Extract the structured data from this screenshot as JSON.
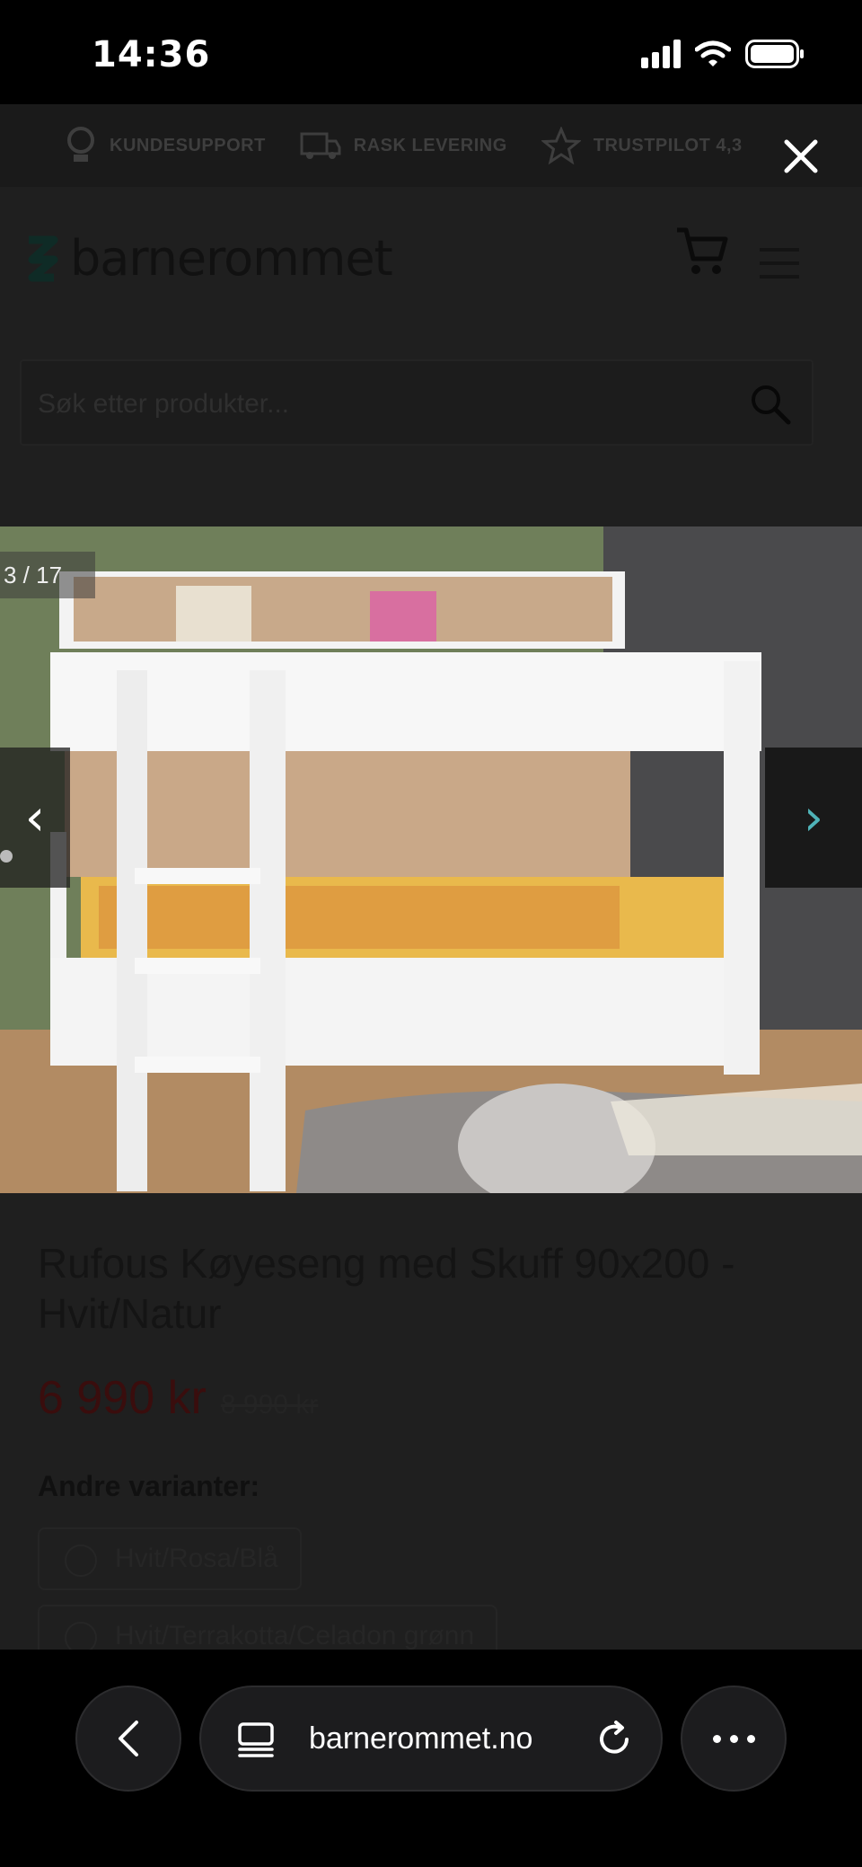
{
  "status_bar": {
    "time": "14:36"
  },
  "usp_bar": {
    "items": [
      {
        "label": "KUNDESUPPORT",
        "icon": "headset-icon"
      },
      {
        "label": "RASK LEVERING",
        "icon": "truck-icon"
      },
      {
        "label": "TRUSTPILOT 4,3",
        "icon": "star-icon"
      }
    ]
  },
  "header": {
    "logo_text": "barnerommet"
  },
  "search": {
    "placeholder": "Søk etter produkter..."
  },
  "gallery": {
    "counter": "3 / 17",
    "prev_glyph": "‹",
    "next_glyph": "›"
  },
  "product": {
    "title": "Rufous Køyeseng med Skuff 90x200 - Hvit/Natur",
    "price": "6 990 kr",
    "old_price": "8 990 kr",
    "variants_label": "Andre varianter:",
    "variants": [
      "Hvit/Rosa/Blå",
      "Hvit/Terrakotta/Celadon grønn"
    ]
  },
  "browser": {
    "url": "barnerommet.no"
  },
  "colors": {
    "accent_teal": "#4fb3b8",
    "price_red": "#3a0d0d"
  }
}
